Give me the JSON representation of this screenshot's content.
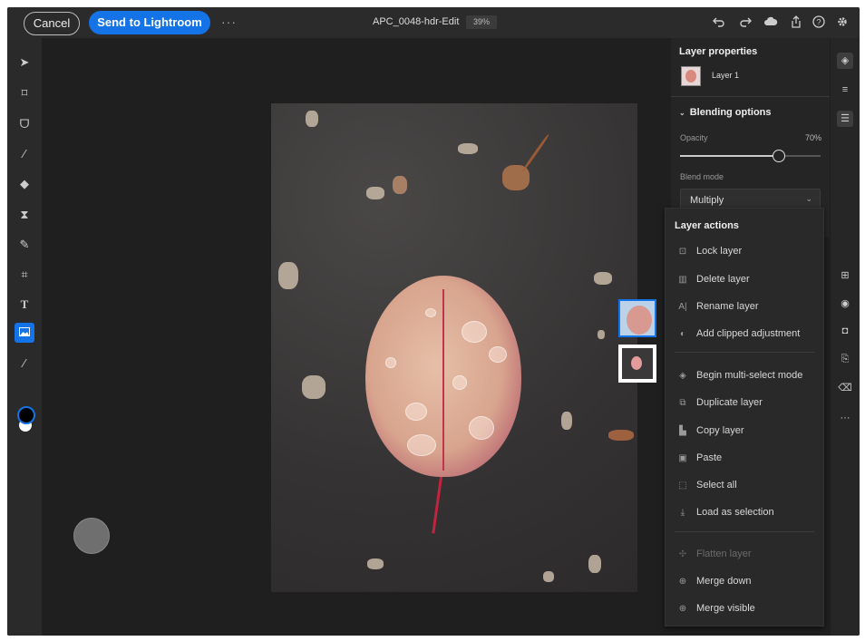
{
  "topbar": {
    "cancel_label": "Cancel",
    "send_label": "Send to Lightroom",
    "more_label": "···",
    "doc_title": "APC_0048-hdr-Edit",
    "zoom": "39%",
    "icons": [
      "undo-icon",
      "redo-icon",
      "cloud-icon",
      "share-icon",
      "help-icon",
      "settings-icon"
    ]
  },
  "left_tools": [
    "move-tool",
    "transform-tool",
    "lasso-tool",
    "brush-tool",
    "eraser-tool",
    "fill-tool",
    "healing-tool",
    "crop-tool",
    "type-tool",
    "place-image-tool",
    "eyedropper-tool"
  ],
  "layer_properties": {
    "title": "Layer properties",
    "layer_name": "Layer 1",
    "blending_header": "Blending options",
    "opacity_label": "Opacity",
    "opacity_value": "70%",
    "opacity_fraction": 0.7,
    "blend_mode_label": "Blend mode",
    "blend_mode_value": "Multiply"
  },
  "layer_actions": {
    "title": "Layer actions",
    "groups": [
      [
        {
          "label": "Lock layer",
          "icon": "lock-icon",
          "enabled": true
        },
        {
          "label": "Delete layer",
          "icon": "trash-icon",
          "enabled": true
        },
        {
          "label": "Rename layer",
          "icon": "rename-icon",
          "enabled": true
        },
        {
          "label": "Add clipped adjustment",
          "icon": "adjustment-icon",
          "enabled": true
        }
      ],
      [
        {
          "label": "Begin multi-select mode",
          "icon": "multiselect-icon",
          "enabled": true
        },
        {
          "label": "Duplicate layer",
          "icon": "duplicate-icon",
          "enabled": true
        },
        {
          "label": "Copy layer",
          "icon": "copy-icon",
          "enabled": true
        },
        {
          "label": "Paste",
          "icon": "paste-icon",
          "enabled": true
        },
        {
          "label": "Select all",
          "icon": "select-all-icon",
          "enabled": true
        },
        {
          "label": "Load as selection",
          "icon": "load-selection-icon",
          "enabled": true
        }
      ],
      [
        {
          "label": "Flatten layer",
          "icon": "flatten-icon",
          "enabled": false
        },
        {
          "label": "Merge down",
          "icon": "merge-down-icon",
          "enabled": true
        },
        {
          "label": "Merge visible",
          "icon": "merge-visible-icon",
          "enabled": true
        }
      ]
    ]
  },
  "right_rail": [
    "layers-icon",
    "layer-stack-icon",
    "adjust-icon",
    "add-layer-icon",
    "visibility-icon",
    "mask-icon",
    "properties-icon",
    "clear-icon",
    "more-icon"
  ],
  "colors": {
    "accent": "#1473e6",
    "background": "#1f1f1f",
    "panel": "#252525"
  }
}
